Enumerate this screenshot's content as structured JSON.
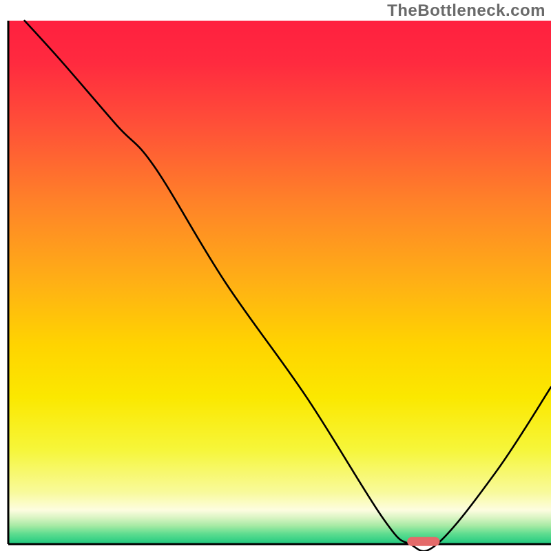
{
  "watermark": "TheBottleneck.com",
  "chart_data": {
    "type": "line",
    "title": "",
    "xlabel": "",
    "ylabel": "",
    "xlim": [
      0,
      100
    ],
    "ylim": [
      0,
      100
    ],
    "line": {
      "name": "bottleneck-curve",
      "x": [
        3,
        10,
        20,
        27,
        40,
        55,
        69,
        74,
        79,
        90,
        100
      ],
      "y": [
        100,
        92,
        80,
        72,
        50,
        28,
        5,
        0,
        0,
        14,
        30
      ]
    },
    "marker": {
      "name": "optimal-segment",
      "x_start": 73.5,
      "x_end": 79.5,
      "y": 0.5,
      "color": "#e46a6a"
    },
    "gradient_stops": [
      {
        "pct": 0.0,
        "color": "#ff203f"
      },
      {
        "pct": 0.08,
        "color": "#ff2a3f"
      },
      {
        "pct": 0.2,
        "color": "#ff5038"
      },
      {
        "pct": 0.35,
        "color": "#ff8328"
      },
      {
        "pct": 0.5,
        "color": "#ffb015"
      },
      {
        "pct": 0.62,
        "color": "#ffd400"
      },
      {
        "pct": 0.72,
        "color": "#fbe800"
      },
      {
        "pct": 0.82,
        "color": "#f6f63a"
      },
      {
        "pct": 0.9,
        "color": "#f8fa9a"
      },
      {
        "pct": 0.935,
        "color": "#fdfde0"
      },
      {
        "pct": 0.95,
        "color": "#d8f4c2"
      },
      {
        "pct": 0.965,
        "color": "#a6eaa4"
      },
      {
        "pct": 0.98,
        "color": "#5fdd90"
      },
      {
        "pct": 1.0,
        "color": "#1fc97f"
      }
    ],
    "axis": {
      "stroke": "#000000",
      "width": 3
    }
  }
}
